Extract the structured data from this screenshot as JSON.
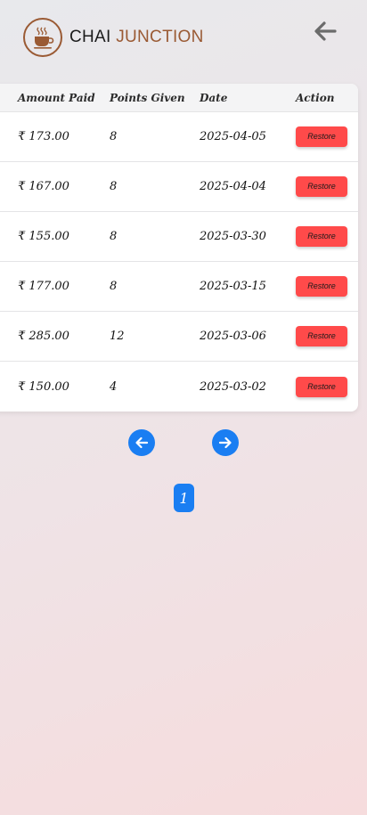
{
  "app": {
    "brand_part1": "CHAI",
    "brand_part2": "JUNCTION",
    "brand_color": "#9a5a34",
    "logo_icon": "coffee-cup-icon",
    "back_icon": "arrow-left-icon"
  },
  "table": {
    "headers": [
      "Amount Paid",
      "Points Given",
      "Date",
      "Action"
    ],
    "rows": [
      {
        "amount": "₹ 173.00",
        "points": "8",
        "date": "2025-04-05",
        "action": "Restore"
      },
      {
        "amount": "₹ 167.00",
        "points": "8",
        "date": "2025-04-04",
        "action": "Restore"
      },
      {
        "amount": "₹ 155.00",
        "points": "8",
        "date": "2025-03-30",
        "action": "Restore"
      },
      {
        "amount": "₹ 177.00",
        "points": "8",
        "date": "2025-03-15",
        "action": "Restore"
      },
      {
        "amount": "₹ 285.00",
        "points": "12",
        "date": "2025-03-06",
        "action": "Restore"
      },
      {
        "amount": "₹ 150.00",
        "points": "4",
        "date": "2025-03-02",
        "action": "Restore"
      }
    ]
  },
  "pagination": {
    "current_page": "1",
    "prev_icon": "arrow-left-icon",
    "next_icon": "arrow-right-icon",
    "accent_color": "#1a7ef2"
  },
  "colors": {
    "restore_button": "#ff4a4a"
  }
}
